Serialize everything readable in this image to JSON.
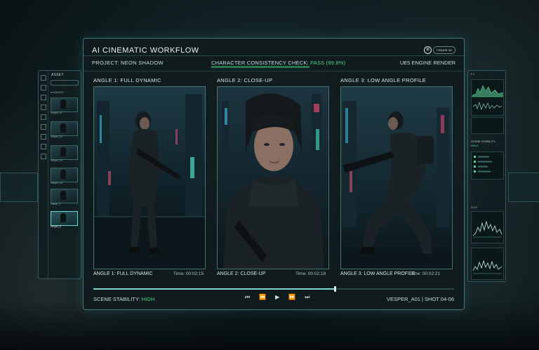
{
  "window": {
    "title": "AI CINEMATIC WORKFLOW",
    "header_button": "CREATE 3D"
  },
  "header": {
    "project_label": "PROJECT: NEON SHADOW",
    "check_label": "CHARACTER CONSISTENCY CHECK:",
    "check_status": "PASS (99.8%)",
    "engine": "UE5 ENGINE RENDER"
  },
  "shots": [
    {
      "title": "ANGLE 1: FULL DYNAMIC",
      "caption": "ANGLE 1: FULL DYNAMIC",
      "time": "Time: 00:02:15"
    },
    {
      "title": "ANGLE 2: CLOSE-UP",
      "caption": "ANGLE 2: CLOSE-UP",
      "time": "Time: 00:02:18"
    },
    {
      "title": "ANGLE 3: LOW ANGLE PROFILE",
      "caption": "ANGLE 3: LOW ANGLE PROFILE",
      "time": "Time: 00:02:21"
    }
  ],
  "timeline": {
    "progress": 0.67
  },
  "footer": {
    "stability_label": "SCENE STABILITY:",
    "stability_value": "HIGH",
    "shot_id": "VESPER_A01 | SHOT 04-06"
  },
  "controls": {
    "skip_back": "⏮",
    "rewind": "⏪",
    "play": "▶",
    "forward": "⏩",
    "skip_forward": "⏭"
  },
  "asset_panel": {
    "title": "ASSET",
    "folder": "▾ IMAGES",
    "items": [
      "Vesper_01",
      "Vesper_02",
      "Vesper_03",
      "Vesper_04",
      "Frame_2",
      "Vesper_5"
    ]
  },
  "right_panel": {
    "title": "E.3",
    "stability_label": "SCENE STABILITY:",
    "stability_value": "HIGH",
    "section": "SHOT"
  },
  "colors": {
    "accent": "#7fd7d0",
    "pass": "#4fd68c",
    "panel": "#101b1d"
  }
}
